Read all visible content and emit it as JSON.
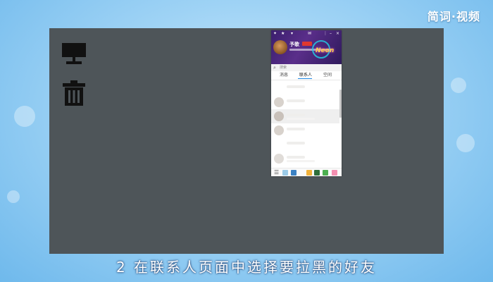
{
  "brand": "简词·视频",
  "caption": "2 在联系人页面中选择要拉黑的好友",
  "desktop_icons": [
    "monitor-icon",
    "trash-icon"
  ],
  "qq": {
    "nickname": "予歌",
    "banner_text": "Neon",
    "search_placeholder": "搜索",
    "tabs": [
      {
        "label": "消息"
      },
      {
        "label": "联系人"
      },
      {
        "label": "空间"
      }
    ],
    "dock_icons": [
      "menu-icon",
      "phone-icon",
      "file-icon",
      "tools-icon",
      "game-icon",
      "game-icon",
      "app-icon",
      "app-icon"
    ]
  },
  "colors": {
    "desktop": "#4e5559",
    "accent": "#1e88e5",
    "vip": "#e0382f"
  }
}
